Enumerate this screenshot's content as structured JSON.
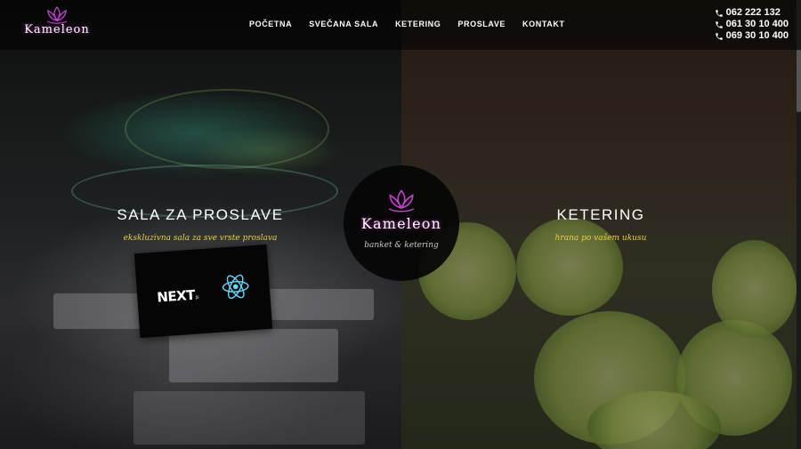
{
  "brand": {
    "name": "Kameleon",
    "tagline": "banket & ketering"
  },
  "nav": {
    "items": [
      {
        "label": "POČETNA"
      },
      {
        "label": "SVEČANA SALA"
      },
      {
        "label": "KETERING"
      },
      {
        "label": "PROSLAVE"
      },
      {
        "label": "KONTAKT"
      }
    ]
  },
  "contact": {
    "phones": [
      "062 222 132",
      "061 30 10 400",
      "069 30 10 400"
    ]
  },
  "sections": {
    "left": {
      "title": "SALA ZA PROSLAVE",
      "subtitle": "ekskluzivna sala za sve vrste proslava"
    },
    "right": {
      "title": "KETERING",
      "subtitle": "hrana po vašem ukusu"
    }
  },
  "overlay": {
    "next_label": "NEXT",
    "next_suffix": ".js"
  },
  "colors": {
    "accent": "#c040c8",
    "subtitle": "#e8d23a"
  },
  "icons": {
    "phone": "phone-icon",
    "logo": "lotus-icon",
    "react": "react-icon"
  }
}
